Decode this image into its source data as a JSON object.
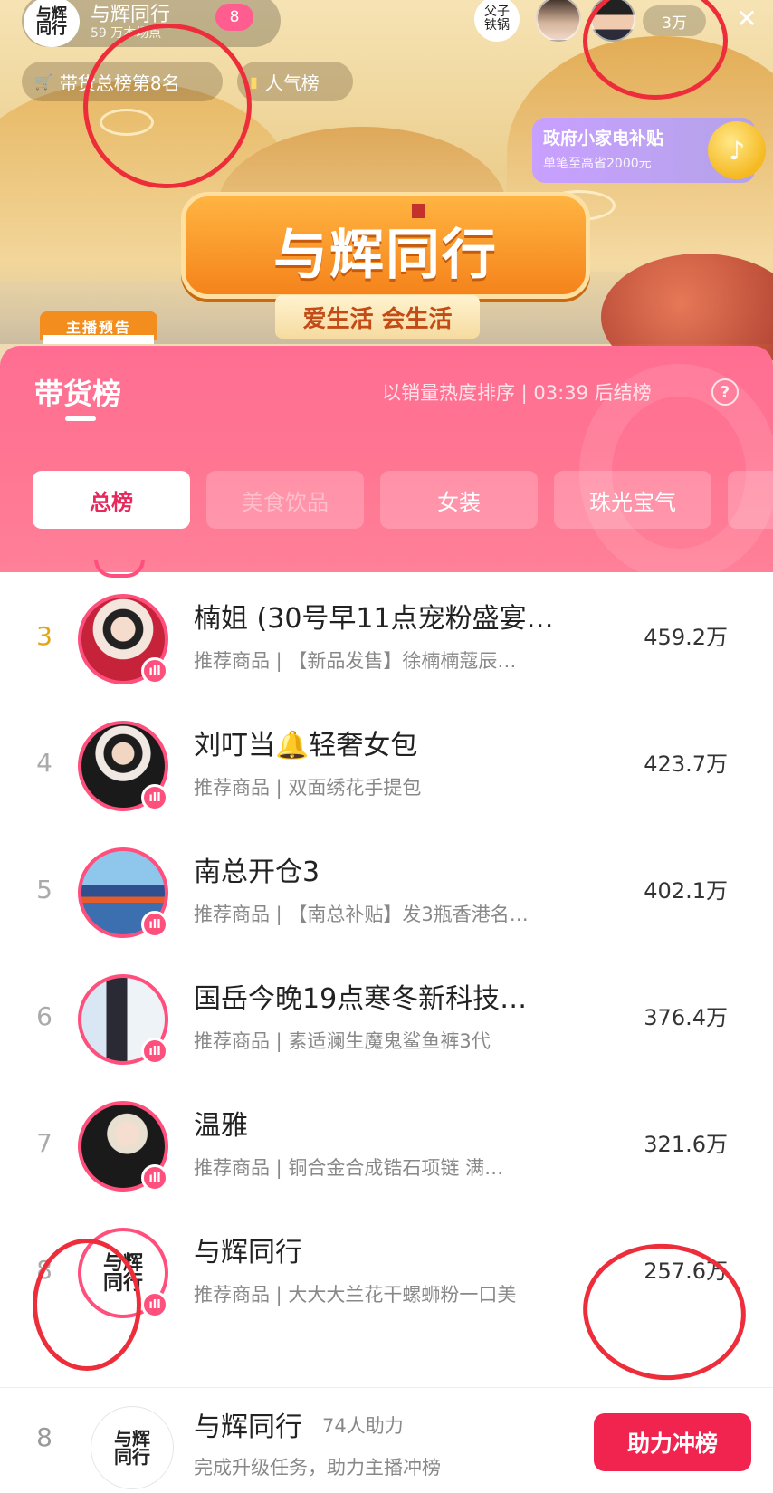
{
  "header": {
    "anchor_avatar_text": "与辉\n同行",
    "anchor_name": "与辉同行",
    "anchor_stat": "59 万本场点",
    "fans_level": "8",
    "viewers": [
      {
        "text": "父子\n铁锅"
      },
      {
        "text": ""
      },
      {
        "text": ""
      }
    ],
    "viewer_count": "3万",
    "close_icon": "✕"
  },
  "chips": {
    "sales_rank": "带货总榜第8名",
    "popularity": "人气榜"
  },
  "subsidy": {
    "title": "政府小家电补贴",
    "desc": "单笔至高省2000元",
    "coin_icon": "♪"
  },
  "banner": {
    "title": "与辉同行",
    "slogan": "爱生活 会生活",
    "preview_label": "主播预告"
  },
  "panel": {
    "title": "带货榜",
    "sort_info": "以销量热度排序 | 03:39 后结榜",
    "help_icon": "?",
    "tabs": [
      {
        "label": "总榜",
        "active": true
      },
      {
        "label": "美食饮品",
        "active": false
      },
      {
        "label": "女装",
        "active": false
      },
      {
        "label": "珠光宝气",
        "active": false
      },
      {
        "label": "",
        "active": false
      }
    ]
  },
  "list": [
    {
      "rank": "3",
      "name": "楠姐 (30号早11点宠粉盛宴…",
      "desc": "推荐商品 | 【新品发售】徐楠楠蔻辰…",
      "score": "459.2万"
    },
    {
      "rank": "4",
      "name": "刘叮当🔔轻奢女包",
      "desc": "推荐商品 | 双面绣花手提包",
      "score": "423.7万"
    },
    {
      "rank": "5",
      "name": "南总开仓3",
      "desc": "推荐商品 | 【南总补贴】发3瓶香港名…",
      "score": "402.1万"
    },
    {
      "rank": "6",
      "name": "国岳今晚19点寒冬新科技…",
      "desc": "推荐商品 | 素适澜生魔鬼鲨鱼裤3代",
      "score": "376.4万"
    },
    {
      "rank": "7",
      "name": "温雅",
      "desc": "推荐商品 | 铜合金合成锆石项链 满…",
      "score": "321.6万"
    },
    {
      "rank": "8",
      "name": "与辉同行",
      "desc": "推荐商品 | 大大大兰花干螺蛳粉一口美",
      "score": "257.6万",
      "avatar_text": "与辉\n同行"
    }
  ],
  "live_icon": "ıll",
  "self": {
    "rank": "8",
    "avatar_text": "与辉\n同行",
    "name": "与辉同行",
    "help_count": "74人助力",
    "desc": "完成升级任务，助力主播冲榜",
    "button_label": "助力冲榜"
  },
  "colors": {
    "accent": "#ff4f7d",
    "button": "#f0244f",
    "annotation": "#ee2d3b",
    "gold_rank": "#e2a516"
  }
}
